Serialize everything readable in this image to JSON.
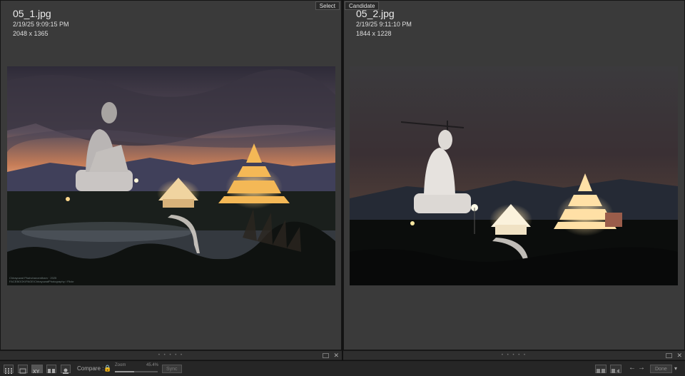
{
  "left_pane": {
    "tag": "Select",
    "filename": "05_1.jpg",
    "datetime": "2/19/25 9:09:15 PM",
    "dimensions": "2048 x 1365",
    "watermark_line1": "Chirayuwat Phahcharoentham · 2025",
    "watermark_line2": "FACEBOOK/PAGE/ChirayuwatPhotography / Flickr"
  },
  "right_pane": {
    "tag": "Candidate",
    "filename": "05_2.jpg",
    "datetime": "2/19/25 9:11:10 PM",
    "dimensions": "1844 x 1228"
  },
  "footer": {
    "grip": "• • • • •",
    "close": "✕"
  },
  "toolbar": {
    "compare_label": "Compare :",
    "zoom_label": "Zoom",
    "zoom_value": "45.4%",
    "zoom_level": 0.454,
    "sync_label": "Sync",
    "done_label": "Done",
    "prev_arrow": "←",
    "next_arrow": "→",
    "menu_arrow": "▾",
    "lock_icon": "🔒"
  },
  "colors": {
    "panel_bg": "#3a3a3a",
    "toolbar_bg": "#262626",
    "select_sky_top": "#2e2b38",
    "candidate_sky_top": "#3b3a3d"
  }
}
